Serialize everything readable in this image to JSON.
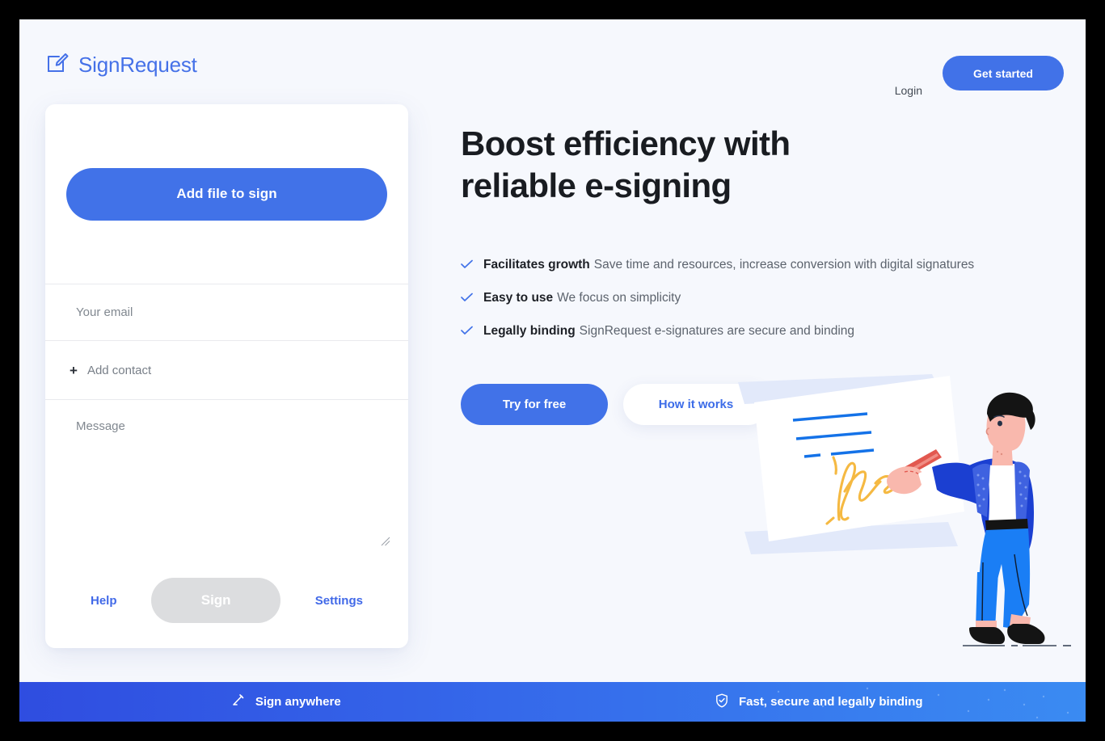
{
  "header": {
    "logo_text": "SignRequest",
    "logo_icon": "document-pen-icon",
    "login_label": "Login",
    "get_started_label": "Get started"
  },
  "form_card": {
    "add_file_label": "Add file to sign",
    "email": {
      "value": "",
      "placeholder": "Your email"
    },
    "add_contact": {
      "plus": "+",
      "label": "Add contact"
    },
    "message": {
      "value": "",
      "placeholder": "Message"
    },
    "resize_handle_icon": "resize-handle-icon",
    "help_label": "Help",
    "sign_label": "Sign",
    "settings_label": "Settings"
  },
  "hero": {
    "title": "Boost efficiency with reliable e-signing",
    "features": [
      {
        "icon": "check-icon",
        "lead": "Facilitates growth",
        "desc": "Save time and resources, increase conversion with digital signatures"
      },
      {
        "icon": "check-icon",
        "lead": "Easy to use",
        "desc": "We focus on simplicity"
      },
      {
        "icon": "check-icon",
        "lead": "Legally binding",
        "desc": "SignRequest e-signatures are secure and binding"
      }
    ],
    "try_free_label": "Try for free",
    "how_it_works_label": "How it works"
  },
  "illustration": {
    "name": "person-signing-document-illustration"
  },
  "bottom_bar": {
    "items": [
      {
        "icon": "pen-icon",
        "label": "Sign anywhere"
      },
      {
        "icon": "shield-check-icon",
        "label": "Fast, secure and legally binding"
      }
    ]
  },
  "colors": {
    "accent_blue": "#4172e8",
    "page_background": "#f6f8fd",
    "card_background": "#ffffff",
    "disabled_gray": "#dcdddf",
    "bar_gradient_start": "#2f4de0",
    "bar_gradient_end": "#3a8bf2",
    "signature_gold": "#f5b942",
    "pen_red": "#e2584f",
    "jacket_blue": "#1b3fd1",
    "trouser_blue": "#1a7ef5",
    "skin": "#f9b8ad",
    "hair_black": "#141414"
  }
}
